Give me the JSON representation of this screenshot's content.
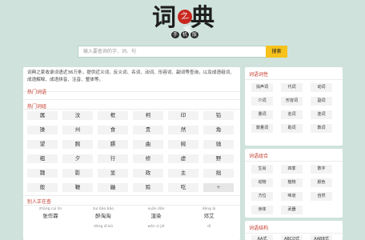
{
  "logo": {
    "char1": "词",
    "char2": "典",
    "seal": "之家",
    "sub": [
      "手",
      "机",
      "版"
    ]
  },
  "search": {
    "placeholder": "输入要查询的字、词、句",
    "button": "搜索"
  },
  "main": {
    "intro": "词典之家收录词语近36万条，提供近义词、反义词、名词、动词、形容词、副词等查询，以及成语组词、成语解释、成语拼音、注音、整体等。",
    "section_hot_words": "热门词语",
    "section_hot_chars": "热门词组",
    "chars": [
      [
        "属",
        "汶",
        "框",
        "柯",
        "印",
        "铅"
      ],
      [
        "操",
        "州",
        "食",
        "贵",
        "然",
        "角"
      ],
      [
        "望",
        "腕",
        "膘",
        "曲",
        "婉",
        "驰"
      ],
      [
        "粗",
        "夕",
        "行",
        "修",
        "虚",
        "野"
      ],
      [
        "魏",
        "影",
        "显",
        "政",
        "主",
        "拙"
      ],
      [
        "般",
        "鞭",
        "鼬",
        "赊",
        "吃",
        "+"
      ]
    ],
    "section_people": "别人正在查",
    "people": [
      {
        "pinyin": "zhāng cuì lín",
        "name": "张作霖"
      },
      {
        "pinyin": "zuì bǎo bǎo",
        "name": "醉淘淘"
      },
      {
        "pinyin": "xuān dǎn",
        "name": "渲染"
      },
      {
        "pinyin": "dēng ài",
        "name": "邓艾"
      },
      {
        "pinyin": "",
        "name": ""
      },
      {
        "pinyin": "dēng dǐ bǔ",
        "name": ""
      },
      {
        "pinyin": "wēn sì jié",
        "name": ""
      },
      {
        "pinyin": "dǐ",
        "name": ""
      }
    ]
  },
  "side_word_class": {
    "title": "词语词性",
    "tags": [
      "拟声词",
      "代词",
      "动词",
      "介词",
      "形容词",
      "副词",
      "量词",
      "名词",
      "连词",
      "数量词",
      "助词",
      "数词"
    ]
  },
  "side_word_combo": {
    "title": "词语组合",
    "tags": [
      "生肖",
      "四季",
      "数字",
      "动物",
      "植物",
      "颜色",
      "方位",
      "味道",
      "自然",
      "身体",
      "武器",
      ""
    ]
  },
  "side_word_form": {
    "title": "词语结构",
    "tags": [
      "AA式",
      "ABCD式",
      "AABB式"
    ]
  }
}
